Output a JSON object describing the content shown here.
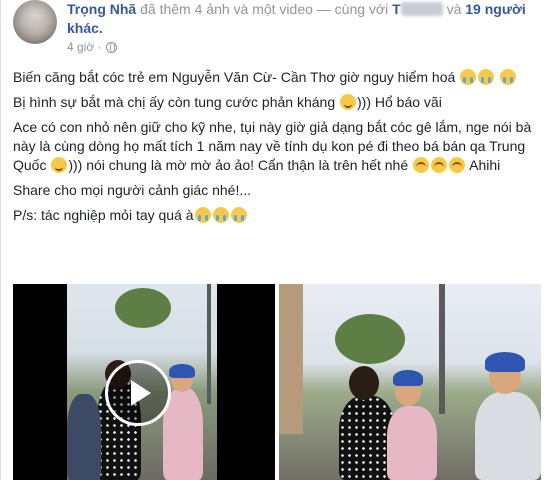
{
  "post": {
    "author": "Trọng Nhã",
    "action": "đã thêm 4 ảnh và một video",
    "with_prefix": "— cùng với",
    "with_name": "T",
    "and_others_prefix": "và",
    "and_others_link": "19 người khác.",
    "time": "4 giờ ·",
    "paragraphs": {
      "p1": "Biến căng bắt cóc trẻ em Nguyễn Văn Cừ- Cần Thơ giờ nguy hiểm hoá",
      "p2": "Bị hình sự bắt mà chị ấy còn tung cước phản kháng",
      "p2_tail": "))) Hổ báo vãi",
      "p3": "Ace có con nhỏ nên giữ cho kỹ nhe, tụi này giờ giả dạng bắt cóc gê lắm, nge nói bà này là cùng dòng họ mất tích 1 năm nay về tính dụ kon pé đi theo bá bán qa Trung Quốc",
      "p3_tail": "))) nói chung là mờ mờ ảo ảo! Cẩn thận là trên hết nhé",
      "p3_end": "Ahihi",
      "p4": "Share cho mọi người cảnh giác nhé!...",
      "p5": "P/s: tác nghiệp mỏi tay quá à"
    }
  },
  "colors": {
    "link": "#365899",
    "meta": "#90949c",
    "text": "#1d2129"
  }
}
